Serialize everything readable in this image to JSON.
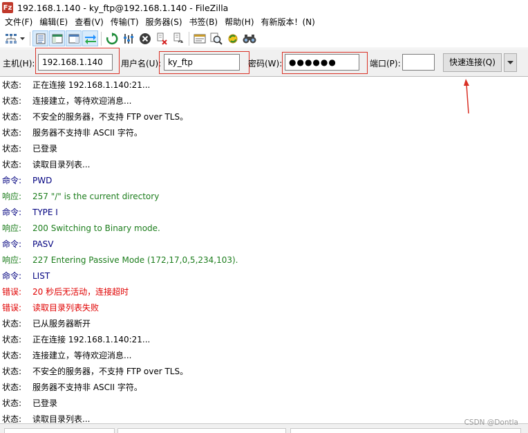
{
  "window": {
    "title": "192.168.1.140 - ky_ftp@192.168.1.140 - FileZilla",
    "app_icon_text": "Fz"
  },
  "menu": [
    {
      "label": "文件(F)"
    },
    {
      "label": "编辑(E)"
    },
    {
      "label": "查看(V)"
    },
    {
      "label": "传输(T)"
    },
    {
      "label": "服务器(S)"
    },
    {
      "label": "书签(B)"
    },
    {
      "label": "帮助(H)"
    },
    {
      "label": "有新版本！(N)"
    }
  ],
  "toolbar": {
    "icons": [
      "site-manager-icon",
      "message-log-icon",
      "local-tree-icon",
      "remote-tree-icon",
      "transfer-queue-icon",
      "refresh-icon",
      "process-queue-icon",
      "cancel-icon",
      "disconnect-icon",
      "reconnect-icon",
      "directory-listing-filter-icon",
      "search-remote-icon",
      "sync-browse-icon",
      "find-files-icon"
    ]
  },
  "quickconnect": {
    "host_label": "主机(H):",
    "host_value": "192.168.1.140",
    "user_label": "用户名(U):",
    "user_value": "ky_ftp",
    "pass_label": "密码(W):",
    "pass_value": "●●●●●●",
    "port_label": "端口(P):",
    "port_value": "",
    "button_label": "快速连接(Q)",
    "highlight_color": "#d93025"
  },
  "log": [
    {
      "type": "状态:",
      "kind": "status",
      "msg": "正在连接 192.168.1.140:21..."
    },
    {
      "type": "状态:",
      "kind": "status",
      "msg": "连接建立，等待欢迎消息..."
    },
    {
      "type": "状态:",
      "kind": "status",
      "msg": "不安全的服务器，不支持 FTP over TLS。"
    },
    {
      "type": "状态:",
      "kind": "status",
      "msg": "服务器不支持非 ASCII 字符。"
    },
    {
      "type": "状态:",
      "kind": "status",
      "msg": "已登录"
    },
    {
      "type": "状态:",
      "kind": "status",
      "msg": "读取目录列表..."
    },
    {
      "type": "命令:",
      "kind": "command",
      "msg": "PWD"
    },
    {
      "type": "响应:",
      "kind": "response",
      "msg": "257 \"/\" is the current directory"
    },
    {
      "type": "命令:",
      "kind": "command",
      "msg": "TYPE I"
    },
    {
      "type": "响应:",
      "kind": "response",
      "msg": "200 Switching to Binary mode."
    },
    {
      "type": "命令:",
      "kind": "command",
      "msg": "PASV"
    },
    {
      "type": "响应:",
      "kind": "response",
      "msg": "227 Entering Passive Mode (172,17,0,5,234,103)."
    },
    {
      "type": "命令:",
      "kind": "command",
      "msg": "LIST"
    },
    {
      "type": "错误:",
      "kind": "error",
      "msg": "20 秒后无活动，连接超时"
    },
    {
      "type": "错误:",
      "kind": "error",
      "msg": "读取目录列表失败"
    },
    {
      "type": "状态:",
      "kind": "status",
      "msg": "已从服务器断开"
    },
    {
      "type": "状态:",
      "kind": "status",
      "msg": "正在连接 192.168.1.140:21..."
    },
    {
      "type": "状态:",
      "kind": "status",
      "msg": "连接建立，等待欢迎消息..."
    },
    {
      "type": "状态:",
      "kind": "status",
      "msg": "不安全的服务器，不支持 FTP over TLS。"
    },
    {
      "type": "状态:",
      "kind": "status",
      "msg": "服务器不支持非 ASCII 字符。"
    },
    {
      "type": "状态:",
      "kind": "status",
      "msg": "已登录"
    },
    {
      "type": "状态:",
      "kind": "status",
      "msg": "读取目录列表..."
    }
  ],
  "colors": {
    "status": "#000000",
    "command": "#00007f",
    "response": "#1c7d1c",
    "error": "#e00000",
    "annotation": "#d93025"
  },
  "watermark": "CSDN @Dontla"
}
